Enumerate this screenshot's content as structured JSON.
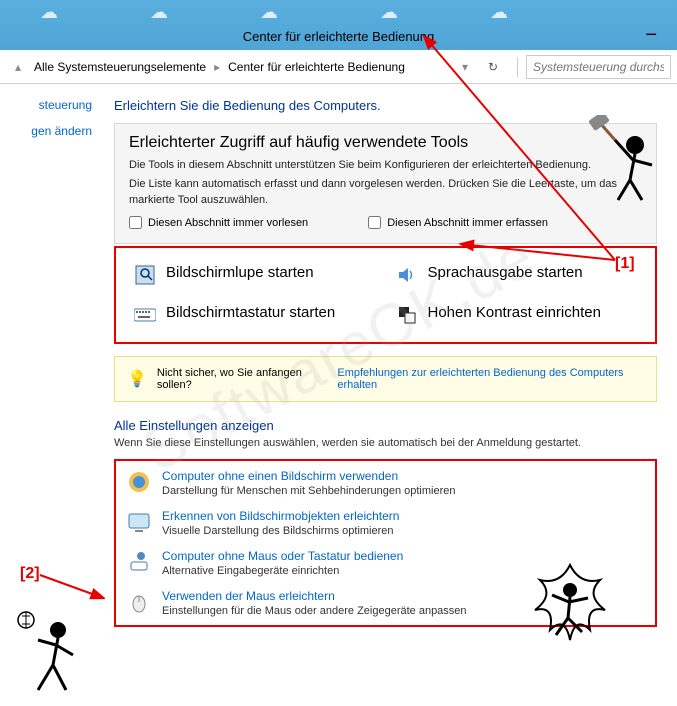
{
  "titlebar": {
    "title": "Center für erleichterte Bedienung"
  },
  "breadcrumb": {
    "item1": "Alle Systemsteuerungselemente",
    "item2": "Center für erleichterte Bedienung"
  },
  "search": {
    "placeholder": "Systemsteuerung durchsu"
  },
  "sidebar": {
    "link1": "steuerung",
    "link2": "gen ändern"
  },
  "header1": "Erleichtern Sie die Bedienung des Computers.",
  "panel": {
    "title": "Erleichterter Zugriff auf häufig verwendete Tools",
    "desc1": "Die Tools in diesem Abschnitt unterstützen Sie beim Konfigurieren der erleichterten Bedienung.",
    "desc2": "Die Liste kann automatisch erfasst und dann vorgelesen werden. Drücken Sie die Leertaste, um das markierte Tool auszuwählen.",
    "cb1": "Diesen Abschnitt immer vorlesen",
    "cb2": "Diesen Abschnitt immer erfassen"
  },
  "tools": {
    "t1": "Bildschirmlupe starten",
    "t2": "Sprachausgabe starten",
    "t3": "Bildschirmtastatur starten",
    "t4": "Hohen Kontrast einrichten"
  },
  "hint": {
    "text": "Nicht sicher, wo Sie anfangen sollen?",
    "link": "Empfehlungen zur erleichterten Bedienung des Computers erhalten"
  },
  "settings": {
    "header": "Alle Einstellungen anzeigen",
    "sub": "Wenn Sie diese Einstellungen auswählen, werden sie automatisch bei der Anmeldung gestartet.",
    "items": [
      {
        "title": "Computer ohne einen Bildschirm verwenden",
        "desc": "Darstellung für Menschen mit Sehbehinderungen optimieren"
      },
      {
        "title": "Erkennen von Bildschirmobjekten erleichtern",
        "desc": "Visuelle Darstellung des Bildschirms optimieren"
      },
      {
        "title": "Computer ohne Maus oder Tastatur bedienen",
        "desc": "Alternative Eingabegeräte einrichten"
      },
      {
        "title": "Verwenden der Maus erleichtern",
        "desc": "Einstellungen für die Maus oder andere Zeigegeräte anpassen"
      }
    ]
  },
  "annotations": {
    "a1": "[1]",
    "a2": "[2]"
  },
  "watermark": "SoftwareOK.de"
}
